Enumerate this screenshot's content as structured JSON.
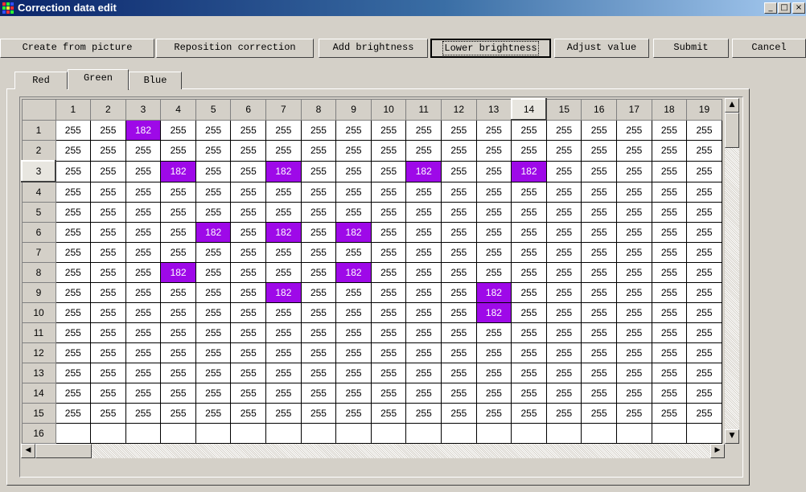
{
  "window": {
    "title": "Correction data edit",
    "minimize": "_",
    "maximize": "□",
    "close": "×"
  },
  "toolbar": {
    "create_from_picture": "Create from picture",
    "reposition_correction": "Reposition correction",
    "add_brightness": "Add brightness",
    "lower_brightness": "Lower brightness",
    "adjust_value": "Adjust value",
    "submit": "Submit",
    "cancel": "Cancel"
  },
  "tabs": [
    "Red",
    "Green",
    "Blue"
  ],
  "active_tab": "Green",
  "grid": {
    "columns": [
      "1",
      "2",
      "3",
      "4",
      "5",
      "6",
      "7",
      "8",
      "9",
      "10",
      "11",
      "12",
      "13",
      "14",
      "15",
      "16",
      "17",
      "18",
      "19"
    ],
    "selected_column": "14",
    "selected_row": "3",
    "highlight_color": "#9e09e8",
    "rows": [
      {
        "label": "1",
        "cells": [
          "255",
          "255",
          "182",
          "255",
          "255",
          "255",
          "255",
          "255",
          "255",
          "255",
          "255",
          "255",
          "255",
          "255",
          "255",
          "255",
          "255",
          "255",
          "255"
        ]
      },
      {
        "label": "2",
        "cells": [
          "255",
          "255",
          "255",
          "255",
          "255",
          "255",
          "255",
          "255",
          "255",
          "255",
          "255",
          "255",
          "255",
          "255",
          "255",
          "255",
          "255",
          "255",
          "255"
        ]
      },
      {
        "label": "3",
        "cells": [
          "255",
          "255",
          "255",
          "182",
          "255",
          "255",
          "182",
          "255",
          "255",
          "255",
          "182",
          "255",
          "255",
          "182",
          "255",
          "255",
          "255",
          "255",
          "255"
        ]
      },
      {
        "label": "4",
        "cells": [
          "255",
          "255",
          "255",
          "255",
          "255",
          "255",
          "255",
          "255",
          "255",
          "255",
          "255",
          "255",
          "255",
          "255",
          "255",
          "255",
          "255",
          "255",
          "255"
        ]
      },
      {
        "label": "5",
        "cells": [
          "255",
          "255",
          "255",
          "255",
          "255",
          "255",
          "255",
          "255",
          "255",
          "255",
          "255",
          "255",
          "255",
          "255",
          "255",
          "255",
          "255",
          "255",
          "255"
        ]
      },
      {
        "label": "6",
        "cells": [
          "255",
          "255",
          "255",
          "255",
          "182",
          "255",
          "182",
          "255",
          "182",
          "255",
          "255",
          "255",
          "255",
          "255",
          "255",
          "255",
          "255",
          "255",
          "255"
        ]
      },
      {
        "label": "7",
        "cells": [
          "255",
          "255",
          "255",
          "255",
          "255",
          "255",
          "255",
          "255",
          "255",
          "255",
          "255",
          "255",
          "255",
          "255",
          "255",
          "255",
          "255",
          "255",
          "255"
        ]
      },
      {
        "label": "8",
        "cells": [
          "255",
          "255",
          "255",
          "182",
          "255",
          "255",
          "255",
          "255",
          "182",
          "255",
          "255",
          "255",
          "255",
          "255",
          "255",
          "255",
          "255",
          "255",
          "255"
        ]
      },
      {
        "label": "9",
        "cells": [
          "255",
          "255",
          "255",
          "255",
          "255",
          "255",
          "182",
          "255",
          "255",
          "255",
          "255",
          "255",
          "182",
          "255",
          "255",
          "255",
          "255",
          "255",
          "255"
        ]
      },
      {
        "label": "10",
        "cells": [
          "255",
          "255",
          "255",
          "255",
          "255",
          "255",
          "255",
          "255",
          "255",
          "255",
          "255",
          "255",
          "182",
          "255",
          "255",
          "255",
          "255",
          "255",
          "255"
        ]
      },
      {
        "label": "11",
        "cells": [
          "255",
          "255",
          "255",
          "255",
          "255",
          "255",
          "255",
          "255",
          "255",
          "255",
          "255",
          "255",
          "255",
          "255",
          "255",
          "255",
          "255",
          "255",
          "255"
        ]
      },
      {
        "label": "12",
        "cells": [
          "255",
          "255",
          "255",
          "255",
          "255",
          "255",
          "255",
          "255",
          "255",
          "255",
          "255",
          "255",
          "255",
          "255",
          "255",
          "255",
          "255",
          "255",
          "255"
        ]
      },
      {
        "label": "13",
        "cells": [
          "255",
          "255",
          "255",
          "255",
          "255",
          "255",
          "255",
          "255",
          "255",
          "255",
          "255",
          "255",
          "255",
          "255",
          "255",
          "255",
          "255",
          "255",
          "255"
        ]
      },
      {
        "label": "14",
        "cells": [
          "255",
          "255",
          "255",
          "255",
          "255",
          "255",
          "255",
          "255",
          "255",
          "255",
          "255",
          "255",
          "255",
          "255",
          "255",
          "255",
          "255",
          "255",
          "255"
        ]
      },
      {
        "label": "15",
        "cells": [
          "255",
          "255",
          "255",
          "255",
          "255",
          "255",
          "255",
          "255",
          "255",
          "255",
          "255",
          "255",
          "255",
          "255",
          "255",
          "255",
          "255",
          "255",
          "255"
        ]
      },
      {
        "label": "16",
        "cells": [
          "",
          "",
          "",
          "",
          "",
          "",
          "",
          "",
          "",
          "",
          "",
          "",
          "",
          "",
          "",
          "",
          "",
          "",
          ""
        ]
      }
    ]
  },
  "scrollbars": {
    "up": "▲",
    "down": "▼",
    "left": "◀",
    "right": "▶"
  }
}
